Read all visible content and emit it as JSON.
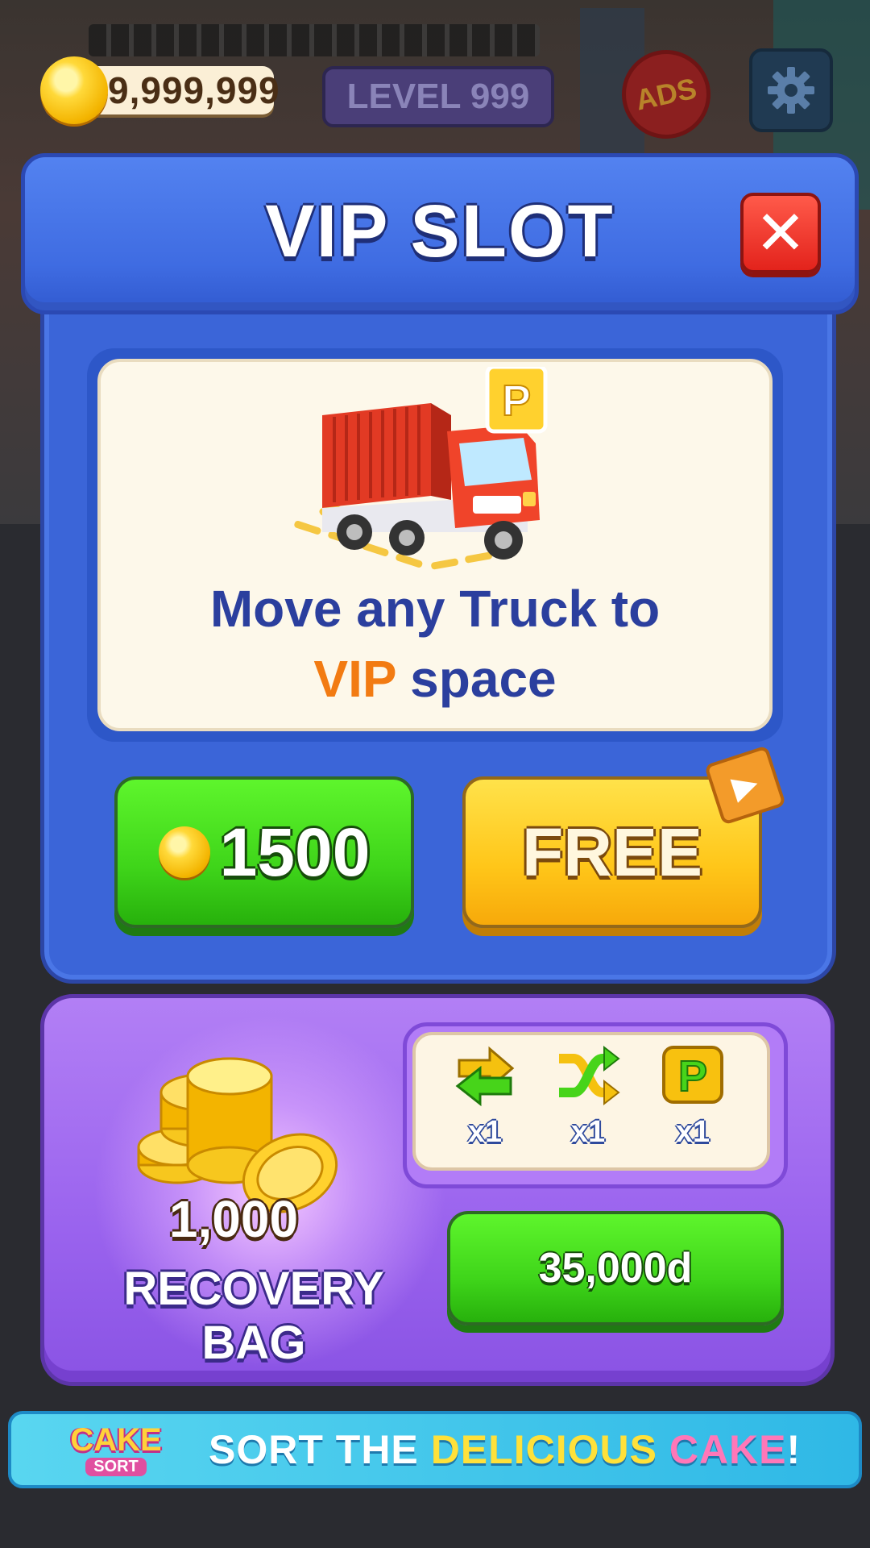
{
  "hud": {
    "coins": "9,999,999",
    "level": "LEVEL 999",
    "ads_badge": "ADS"
  },
  "vip_dialog": {
    "title": "VIP SLOT",
    "close_glyph": "✕",
    "description_line1": "Move any Truck to",
    "description_vip": "VIP",
    "description_rest": " space",
    "parking_badge": "P",
    "buy_price": "1500",
    "free_label": "FREE"
  },
  "recovery_bag": {
    "amount": "1,000",
    "title": "RECOVERY BAG",
    "items": [
      {
        "icon": "swap-arrows-icon",
        "count": "x1"
      },
      {
        "icon": "shuffle-icon",
        "count": "x1"
      },
      {
        "icon": "parking-icon",
        "count": "x1"
      }
    ],
    "parking_letter": "P",
    "price": "35,000d"
  },
  "banner": {
    "logo_top": "CAKE",
    "logo_bottom": "SORT",
    "text_part1": "SORT THE ",
    "text_part2": "DELICIOUS",
    "text_part3": " CAKE",
    "text_part4": "!"
  },
  "colors": {
    "panel_blue": "#3b65d8",
    "panel_purple": "#9a63ee",
    "button_green": "#3fd51a",
    "button_yellow": "#ffc619",
    "close_red": "#e3231c",
    "vip_orange": "#f27b12",
    "text_navy": "#2b3f9e"
  }
}
